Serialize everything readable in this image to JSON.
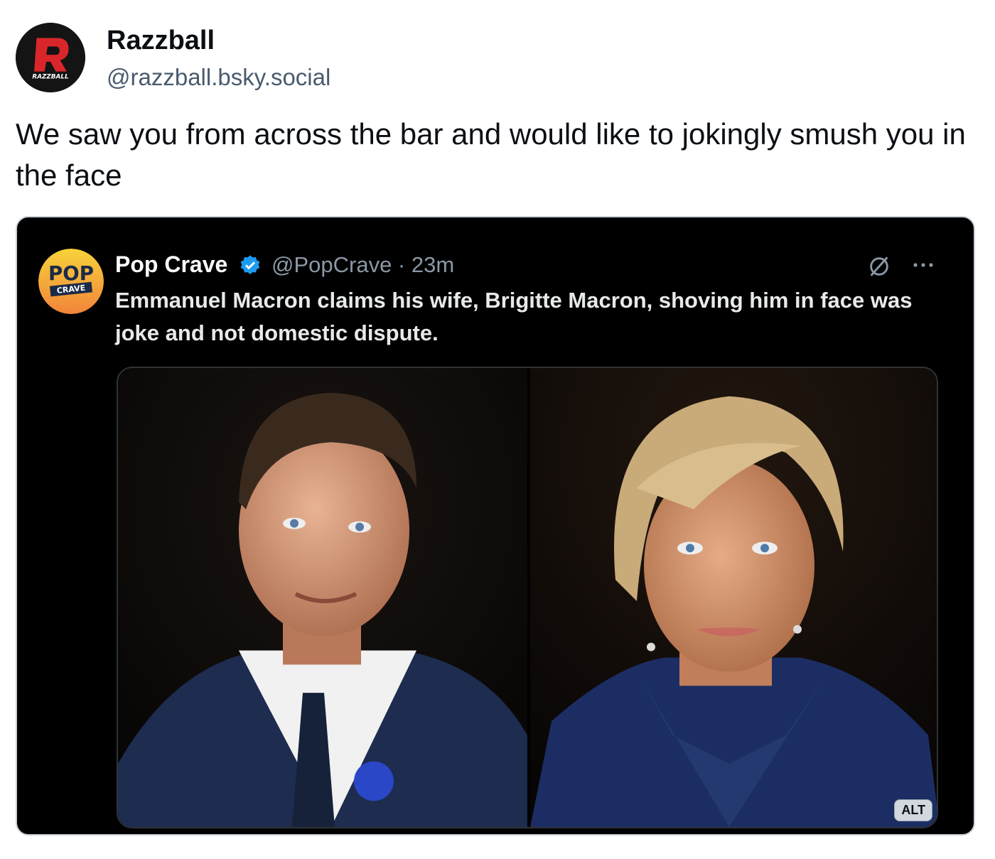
{
  "post": {
    "author": {
      "display_name": "Razzball",
      "handle": "@razzball.bsky.social",
      "avatar_icon": "razzball-logo-icon",
      "avatar_lettering": "RAZZBALL"
    },
    "text": "We saw you from across the bar and would like to jokingly smush you in the face"
  },
  "embed": {
    "author": {
      "display_name": "Pop Crave",
      "handle_time": "@PopCrave · 23m",
      "avatar_icon": "pop-crave-logo-icon",
      "avatar_lettering": "POP CRAVE"
    },
    "text": "Emmanuel Macron claims his wife, Brigitte Macron, shoving him in face was joke and not domestic dispute.",
    "photos": [
      {
        "icon": "man-portrait-photo"
      },
      {
        "icon": "woman-portrait-photo"
      }
    ],
    "alt_label": "ALT"
  },
  "colors": {
    "brand_red": "#d9262b",
    "verified_blue": "#1d9bf0",
    "handle_gray": "#4a5a6d"
  }
}
